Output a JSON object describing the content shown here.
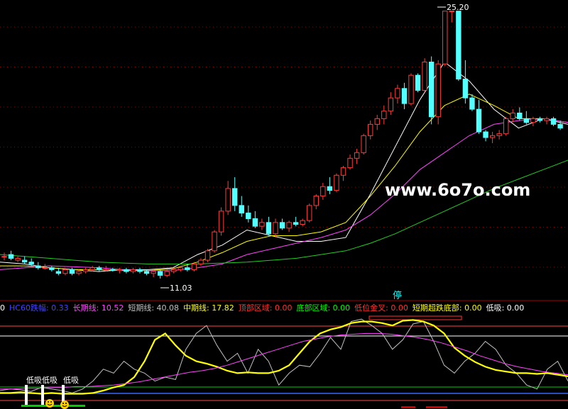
{
  "price_panel": {
    "high_label": "25.20",
    "low_label": "11.03",
    "watermark": "www.6o7o.com",
    "stop_marker": "停"
  },
  "indicator_bar": {
    "items": [
      {
        "text": "0",
        "color": "#ffffff"
      },
      {
        "text": "HC60跌幅: 0.33",
        "color": "#4444ff"
      },
      {
        "text": "长期线: 10.52",
        "color": "#ff44ff"
      },
      {
        "text": "短期线: 40.08",
        "color": "#c0c0c0"
      },
      {
        "text": "中期线: 17.82",
        "color": "#ffff00"
      },
      {
        "text": "顶部区域: 0.00",
        "color": "#ff3333"
      },
      {
        "text": "底部区域: 0.00",
        "color": "#00ff00"
      },
      {
        "text": "低位金叉: 0.00",
        "color": "#ff3333"
      },
      {
        "text": "短期超跌底部: 0.00",
        "color": "#ffff00"
      },
      {
        "text": "低吸: 0.00",
        "color": "#ffffff"
      }
    ]
  },
  "signal_labels": [
    "低吸",
    "低吸",
    "低吸"
  ],
  "chart_data": [
    {
      "type": "candlestick",
      "high_label": 25.2,
      "low_label": 11.03,
      "ylim": [
        10.2,
        25.6
      ],
      "ohlc": [
        [
          12.2,
          12.4,
          12.0,
          12.2
        ],
        [
          12.3,
          12.5,
          12.0,
          12.1
        ],
        [
          12.0,
          12.2,
          11.9,
          12.1
        ],
        [
          12.0,
          12.2,
          11.8,
          11.9
        ],
        [
          11.9,
          12.1,
          11.7,
          11.8
        ],
        [
          11.7,
          11.9,
          11.5,
          11.6
        ],
        [
          11.6,
          11.8,
          11.5,
          11.6
        ],
        [
          11.6,
          11.7,
          11.4,
          11.5
        ],
        [
          11.4,
          11.6,
          11.2,
          11.3
        ],
        [
          11.3,
          11.6,
          11.2,
          11.5
        ],
        [
          11.5,
          11.6,
          11.2,
          11.3
        ],
        [
          11.3,
          11.5,
          11.2,
          11.4
        ],
        [
          11.4,
          11.6,
          11.3,
          11.5
        ],
        [
          11.5,
          11.7,
          11.4,
          11.6
        ],
        [
          11.6,
          11.7,
          11.4,
          11.5
        ],
        [
          11.5,
          11.7,
          11.4,
          11.5
        ],
        [
          11.5,
          11.6,
          11.4,
          11.45
        ],
        [
          11.45,
          11.6,
          11.3,
          11.5
        ],
        [
          11.5,
          11.6,
          11.3,
          11.4
        ],
        [
          11.4,
          11.6,
          11.3,
          11.5
        ],
        [
          11.5,
          11.6,
          11.3,
          11.4
        ],
        [
          11.4,
          11.5,
          11.2,
          11.3
        ],
        [
          11.3,
          11.5,
          11.1,
          11.4
        ],
        [
          11.4,
          11.5,
          11.03,
          11.2
        ],
        [
          11.2,
          11.5,
          11.1,
          11.4
        ],
        [
          11.4,
          11.6,
          11.3,
          11.5
        ],
        [
          11.5,
          11.7,
          11.4,
          11.6
        ],
        [
          11.6,
          11.8,
          11.4,
          11.5
        ],
        [
          11.5,
          11.9,
          11.4,
          11.8
        ],
        [
          11.8,
          12.1,
          11.7,
          12.0
        ],
        [
          12.0,
          12.6,
          11.9,
          12.5
        ],
        [
          12.5,
          13.6,
          12.4,
          13.5
        ],
        [
          13.5,
          14.8,
          13.3,
          14.6
        ],
        [
          14.6,
          16.2,
          14.4,
          15.8
        ],
        [
          15.8,
          16.4,
          14.6,
          14.9
        ],
        [
          14.9,
          15.4,
          14.3,
          14.5
        ],
        [
          14.5,
          14.9,
          14.0,
          14.2
        ],
        [
          14.2,
          14.6,
          13.7,
          13.8
        ],
        [
          13.8,
          14.2,
          13.6,
          14.0
        ],
        [
          14.0,
          14.3,
          13.3,
          13.4
        ],
        [
          13.4,
          14.2,
          13.2,
          14.0
        ],
        [
          14.0,
          14.2,
          13.6,
          13.7
        ],
        [
          13.7,
          14.1,
          13.5,
          14.0
        ],
        [
          14.0,
          14.3,
          13.8,
          13.9
        ],
        [
          13.9,
          14.2,
          13.8,
          14.1
        ],
        [
          14.1,
          15.0,
          14.0,
          14.9
        ],
        [
          14.9,
          15.5,
          14.7,
          15.4
        ],
        [
          15.4,
          16.1,
          15.2,
          15.9
        ],
        [
          15.9,
          16.4,
          15.5,
          15.7
        ],
        [
          15.7,
          16.6,
          15.6,
          16.5
        ],
        [
          16.5,
          17.0,
          16.2,
          16.9
        ],
        [
          16.9,
          17.6,
          16.8,
          17.4
        ],
        [
          17.4,
          17.9,
          17.1,
          17.7
        ],
        [
          17.7,
          18.7,
          17.6,
          18.6
        ],
        [
          18.6,
          19.4,
          18.4,
          19.2
        ],
        [
          19.2,
          19.7,
          18.9,
          19.5
        ],
        [
          19.5,
          20.2,
          19.2,
          19.9
        ],
        [
          19.9,
          20.9,
          19.7,
          20.6
        ],
        [
          20.6,
          21.3,
          20.3,
          21.1
        ],
        [
          21.1,
          21.4,
          20.0,
          20.3
        ],
        [
          20.3,
          21.9,
          20.2,
          21.8
        ],
        [
          21.8,
          21.9,
          20.9,
          21.0
        ],
        [
          21.0,
          22.7,
          20.9,
          22.5
        ],
        [
          22.5,
          22.8,
          19.2,
          19.6
        ],
        [
          19.6,
          22.6,
          19.2,
          22.4
        ],
        [
          22.4,
          25.2,
          22.3,
          25.2
        ],
        [
          25.2,
          25.2,
          24.6,
          25.2
        ],
        [
          25.2,
          25.2,
          21.5,
          21.6
        ],
        [
          21.6,
          22.6,
          20.3,
          20.6
        ],
        [
          20.6,
          20.8,
          19.9,
          20.0
        ],
        [
          20.0,
          20.5,
          18.7,
          18.8
        ],
        [
          18.8,
          18.9,
          18.3,
          18.5
        ],
        [
          18.5,
          18.8,
          18.2,
          18.6
        ],
        [
          18.6,
          18.9,
          18.4,
          18.7
        ],
        [
          18.7,
          19.6,
          18.6,
          19.5
        ],
        [
          19.5,
          20.0,
          19.3,
          19.8
        ],
        [
          19.8,
          20.1,
          19.4,
          19.5
        ],
        [
          19.5,
          19.9,
          19.2,
          19.3
        ],
        [
          19.3,
          19.6,
          19.1,
          19.5
        ],
        [
          19.5,
          19.6,
          19.3,
          19.4
        ],
        [
          19.4,
          19.6,
          19.2,
          19.5
        ],
        [
          19.5,
          19.6,
          19.1,
          19.2
        ],
        [
          19.2,
          19.4,
          18.9,
          19.0
        ]
      ],
      "series": [
        {
          "values": [
            11.9,
            11.8,
            11.6,
            11.5,
            11.4,
            11.5,
            11.5,
            11.6,
            12.3,
            12.8,
            13.6,
            13.3,
            13.0,
            13.0,
            13.2,
            15.5,
            18.0,
            20.5,
            22.5,
            21.5,
            20.0,
            19.0,
            19.5,
            19.2
          ],
          "color": "#ffffff"
        },
        {
          "values": [
            11.7,
            11.7,
            11.6,
            11.5,
            11.5,
            11.45,
            11.45,
            11.55,
            11.9,
            12.4,
            13.0,
            13.3,
            13.3,
            13.5,
            14.0,
            15.4,
            17.0,
            18.8,
            20.2,
            20.8,
            20.2,
            19.5,
            19.5,
            19.3
          ],
          "color": "#ffff00"
        },
        {
          "values": [
            11.5,
            11.6,
            11.7,
            11.65,
            11.6,
            11.5,
            11.45,
            11.45,
            11.6,
            11.8,
            12.3,
            12.6,
            12.9,
            13.2,
            13.6,
            14.4,
            15.5,
            16.8,
            17.7,
            18.6,
            19.2,
            19.4,
            19.5,
            19.3
          ],
          "color": "#ff44ff"
        },
        {
          "values": [
            12.3,
            12.2,
            12.1,
            12.0,
            11.9,
            11.85,
            11.8,
            11.8,
            11.8,
            11.85,
            11.9,
            12.0,
            12.1,
            12.3,
            12.5,
            12.9,
            13.4,
            14.0,
            14.6,
            15.2,
            15.8,
            16.3,
            16.8,
            17.3
          ],
          "color": "#22cc22"
        }
      ]
    },
    {
      "type": "line",
      "ylim": [
        0,
        100
      ],
      "series": [
        {
          "values": [
            8,
            10,
            9,
            7,
            12,
            10,
            8,
            5,
            10,
            20,
            35,
            30,
            45,
            35,
            30,
            20,
            25,
            22,
            60,
            80,
            90,
            65,
            45,
            55,
            30,
            60,
            45,
            15,
            30,
            40,
            38,
            55,
            75,
            60,
            95,
            98,
            90,
            80,
            60,
            72,
            92,
            95,
            70,
            40,
            30,
            45,
            55,
            70,
            60,
            40,
            30,
            15,
            10,
            35,
            45,
            20
          ],
          "color": "#c0c0c0"
        },
        {
          "values": [
            5,
            5,
            6,
            5,
            4,
            5,
            4,
            4,
            4,
            5,
            8,
            12,
            15,
            25,
            45,
            72,
            80,
            65,
            52,
            45,
            42,
            38,
            33,
            30,
            31,
            30,
            30,
            33,
            40,
            55,
            70,
            80,
            85,
            88,
            93,
            95,
            95,
            93,
            90,
            96,
            97,
            95,
            90,
            80,
            62,
            52,
            44,
            38,
            34,
            32,
            30,
            30,
            29,
            30,
            28,
            26
          ],
          "color": "#ffff00"
        },
        {
          "values": [
            10,
            10,
            11,
            11,
            12,
            12,
            13,
            13,
            14,
            15,
            17,
            19,
            22,
            25,
            28,
            31,
            33,
            36,
            40,
            45,
            50,
            55,
            60,
            65,
            70,
            73,
            76,
            78,
            79,
            80,
            80,
            79,
            77,
            75,
            72,
            68,
            63,
            58,
            52,
            47,
            42,
            38,
            35,
            32,
            30,
            28
          ],
          "color": "#ff44ff"
        }
      ]
    }
  ]
}
